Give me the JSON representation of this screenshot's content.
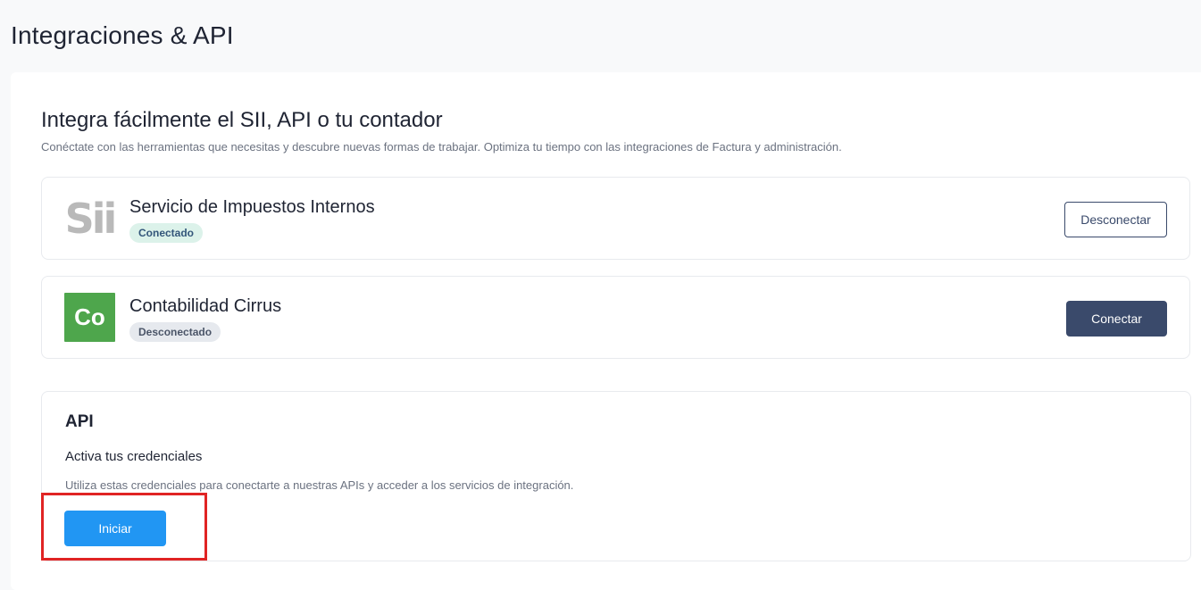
{
  "page": {
    "title": "Integraciones & API"
  },
  "section": {
    "heading": "Integra fácilmente el SII, API o tu contador",
    "subtitle": "Conéctate con las herramientas que necesitas y descubre nuevas formas de trabajar. Optimiza tu tiempo con las integraciones de Factura y administración."
  },
  "integrations": [
    {
      "logo_text": "Sii",
      "logo_icon": "sii-logo-icon",
      "name": "Servicio de Impuestos Internos",
      "status": "Conectado",
      "action_label": "Desconectar"
    },
    {
      "logo_text": "Co",
      "logo_icon": "cirrus-logo-icon",
      "name": "Contabilidad Cirrus",
      "status": "Desconectado",
      "action_label": "Conectar"
    }
  ],
  "api": {
    "title": "API",
    "subtitle": "Activa tus credenciales",
    "description": "Utiliza estas credenciales para conectarte a nuestras APIs y acceder a los servicios de integración.",
    "button_label": "Iniciar"
  },
  "colors": {
    "primary": "#2196f3",
    "navy": "#3a4a6b",
    "cirrus_green": "#4ea64c",
    "highlight_red": "#e02424",
    "connected_badge_bg": "#dcf2ea",
    "disconnected_badge_bg": "#e6e9ee"
  }
}
